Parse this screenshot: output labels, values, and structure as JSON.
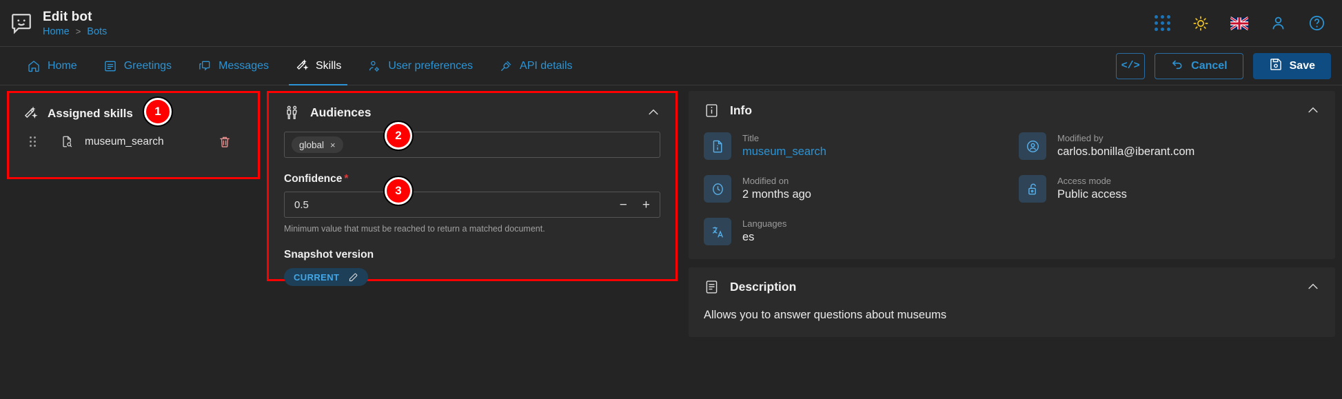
{
  "header": {
    "logo_icon": "chat-bubble-smiley-icon",
    "title": "Edit bot",
    "breadcrumbs": [
      {
        "label": "Home"
      },
      {
        "label": "Bots"
      }
    ],
    "breadcrumb_separator": ">",
    "icons": [
      {
        "name": "apps-grid-icon",
        "color": "#1b74b8"
      },
      {
        "name": "sun-theme-icon",
        "color": "#f2c521"
      },
      {
        "name": "uk-flag-icon",
        "color": "#c8102e"
      },
      {
        "name": "user-account-icon",
        "color": "#2a94d6"
      },
      {
        "name": "help-circle-icon",
        "color": "#2a94d6"
      }
    ]
  },
  "nav": {
    "tabs": [
      {
        "label": "Home",
        "icon": "home-icon",
        "active": false
      },
      {
        "label": "Greetings",
        "icon": "document-lines-icon",
        "active": false
      },
      {
        "label": "Messages",
        "icon": "chat-message-icon",
        "active": false
      },
      {
        "label": "Skills",
        "icon": "magic-wand-icon",
        "active": true
      },
      {
        "label": "User preferences",
        "icon": "user-settings-icon",
        "active": false
      },
      {
        "label": "API details",
        "icon": "api-plug-icon",
        "active": false
      }
    ],
    "actions": {
      "code_label": "</>",
      "cancel_label": "Cancel",
      "save_label": "Save"
    },
    "accent_color": "#2a94d6",
    "save_bg": "#0f4c81"
  },
  "skills_panel": {
    "title": "Assigned skills",
    "add_label": "+",
    "items": [
      {
        "name": "museum_search"
      }
    ],
    "highlight_color": "#fe0000"
  },
  "audiences_panel": {
    "title": "Audiences",
    "chips": [
      {
        "label": "global",
        "remove": "×"
      }
    ],
    "confidence": {
      "label": "Confidence",
      "required_marker": "*",
      "value": "0.5",
      "minus": "−",
      "plus": "+",
      "helper": "Minimum value that must be reached to return a matched document."
    },
    "snapshot": {
      "label": "Snapshot version",
      "pill_label": "CURRENT"
    },
    "highlight_color": "#fe0000"
  },
  "info_panel": {
    "title": "Info",
    "items": [
      {
        "key": "Title",
        "value": "museum_search",
        "icon": "document-info-icon",
        "is_link": true
      },
      {
        "key": "Modified by",
        "value": "carlos.bonilla@iberant.com",
        "icon": "user-circle-icon",
        "is_link": false
      },
      {
        "key": "Modified on",
        "value": "2 months ago",
        "icon": "clock-icon",
        "is_link": false
      },
      {
        "key": "Access mode",
        "value": "Public access",
        "icon": "unlock-icon",
        "is_link": false
      },
      {
        "key": "Languages",
        "value": "es",
        "icon": "translate-icon",
        "is_link": false
      }
    ]
  },
  "description_panel": {
    "title": "Description",
    "text": "Allows you to answer questions about museums"
  },
  "annotations": [
    {
      "number": "1",
      "target": "assigned-skills-panel"
    },
    {
      "number": "2",
      "target": "audiences-chip-input"
    },
    {
      "number": "3",
      "target": "confidence-input"
    }
  ]
}
